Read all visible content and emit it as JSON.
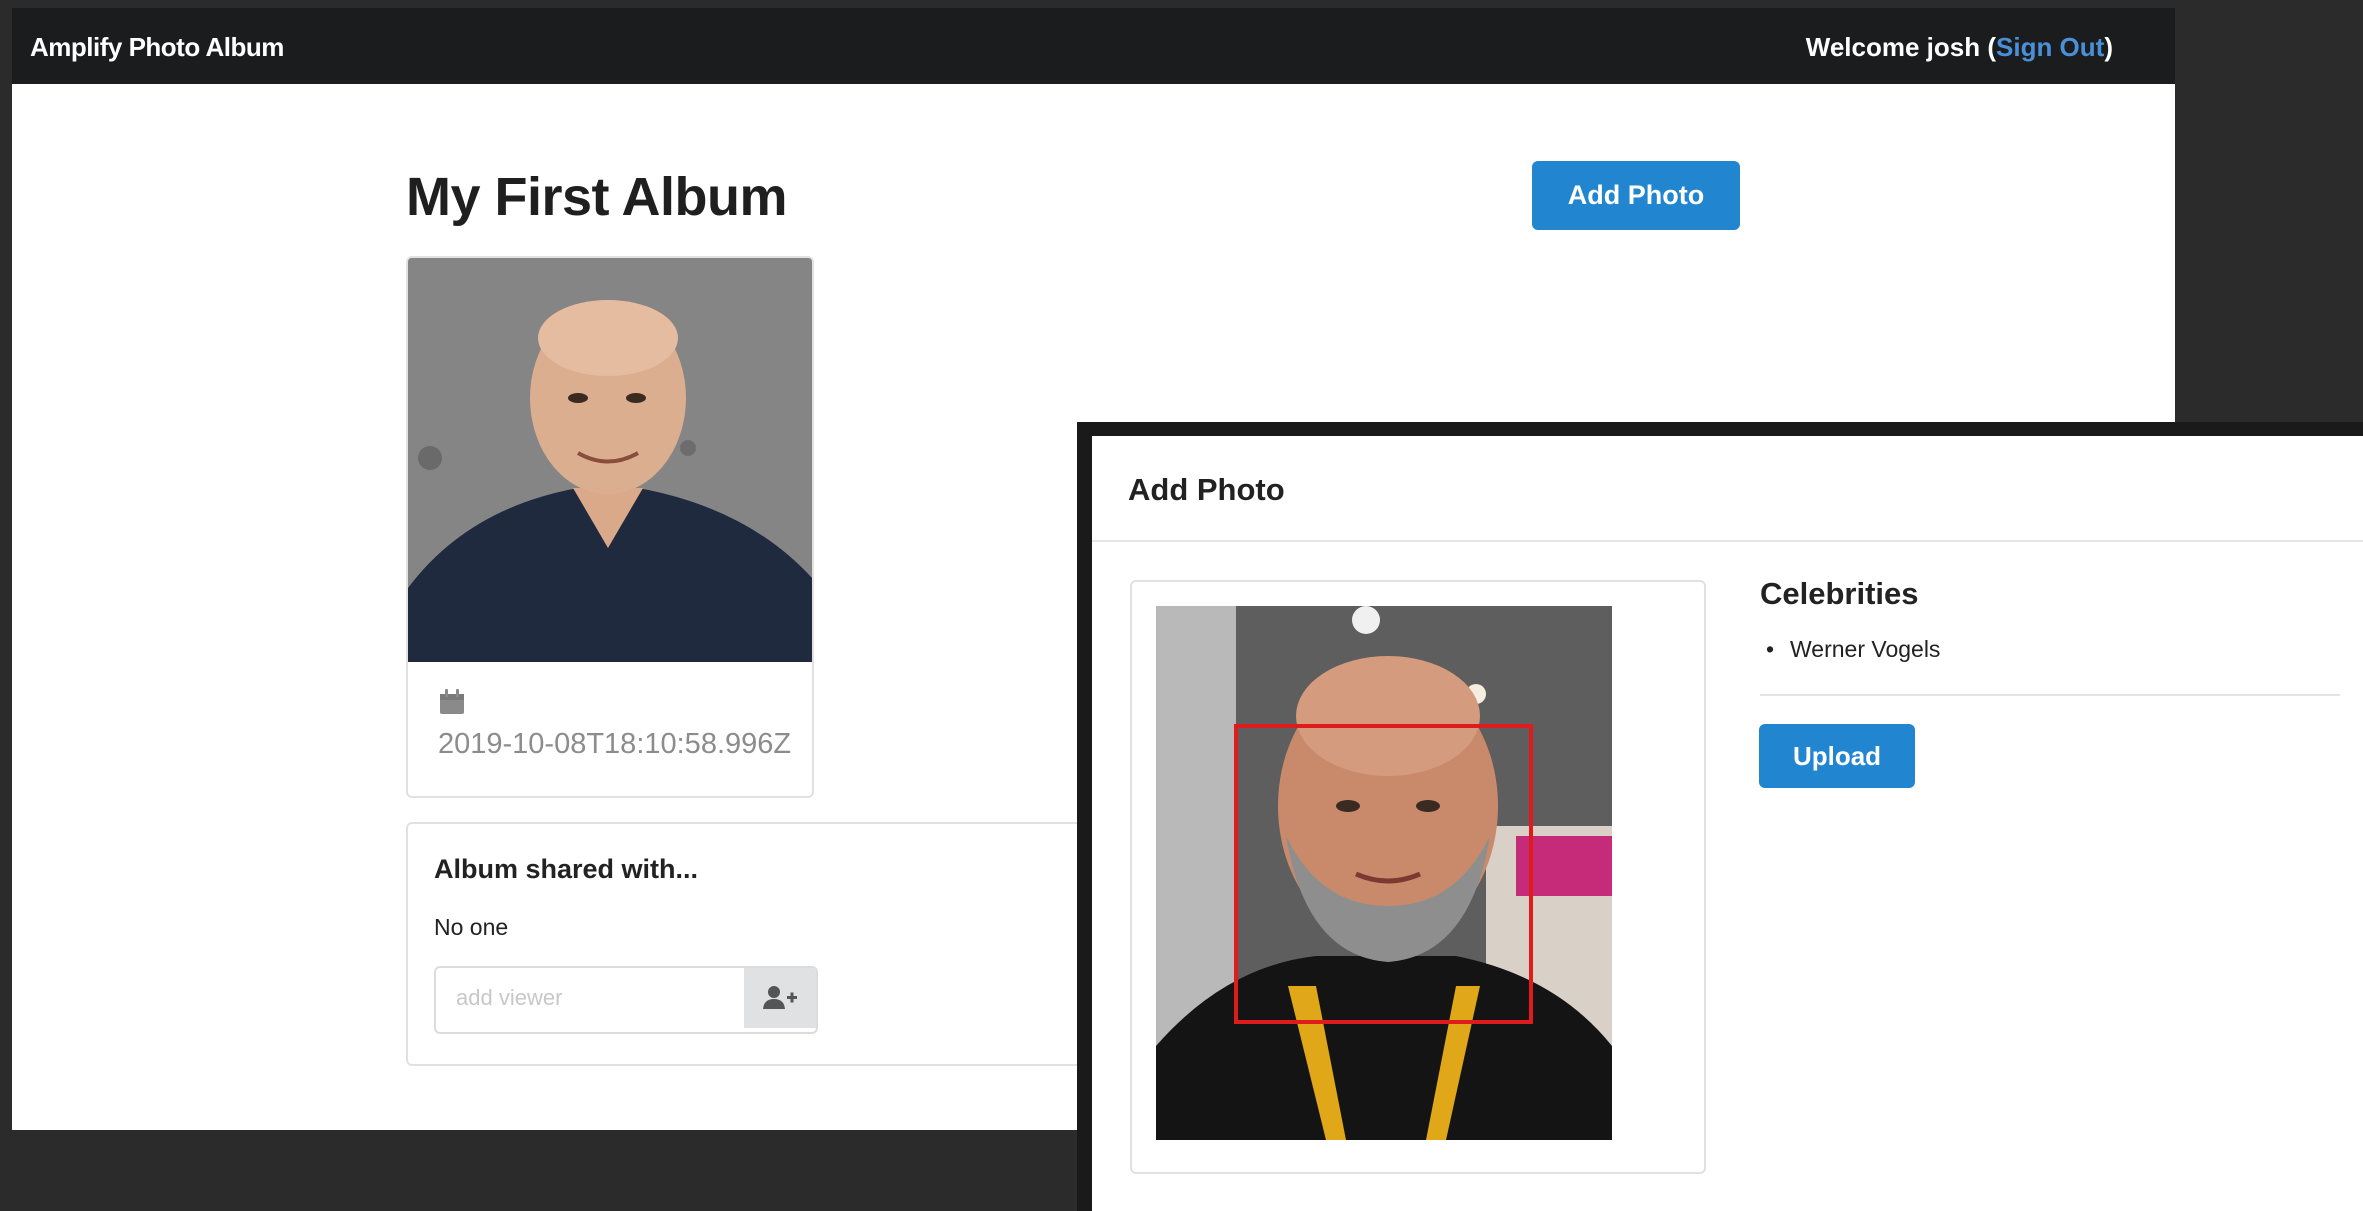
{
  "nav": {
    "brand": "Amplify Photo Album",
    "welcome_prefix": "Welcome josh (",
    "sign_out": "Sign Out",
    "welcome_suffix": ")"
  },
  "album": {
    "title": "My First Album",
    "add_photo_label": "Add Photo",
    "photo": {
      "timestamp": "2019-10-08T18:10:58.996Z",
      "icon": "calendar-icon"
    }
  },
  "share": {
    "title": "Album shared with...",
    "shared_with_text": "No one",
    "input_placeholder": "add viewer",
    "add_icon": "add-user-icon"
  },
  "modal": {
    "title": "Add Photo",
    "celebrities_title": "Celebrities",
    "celebrities": [
      "Werner Vogels"
    ],
    "upload_label": "Upload"
  },
  "colors": {
    "nav_bg": "#1b1c1d",
    "primary_button": "#2185d0",
    "link": "#4a90d9",
    "face_box": "#e01b1b"
  }
}
